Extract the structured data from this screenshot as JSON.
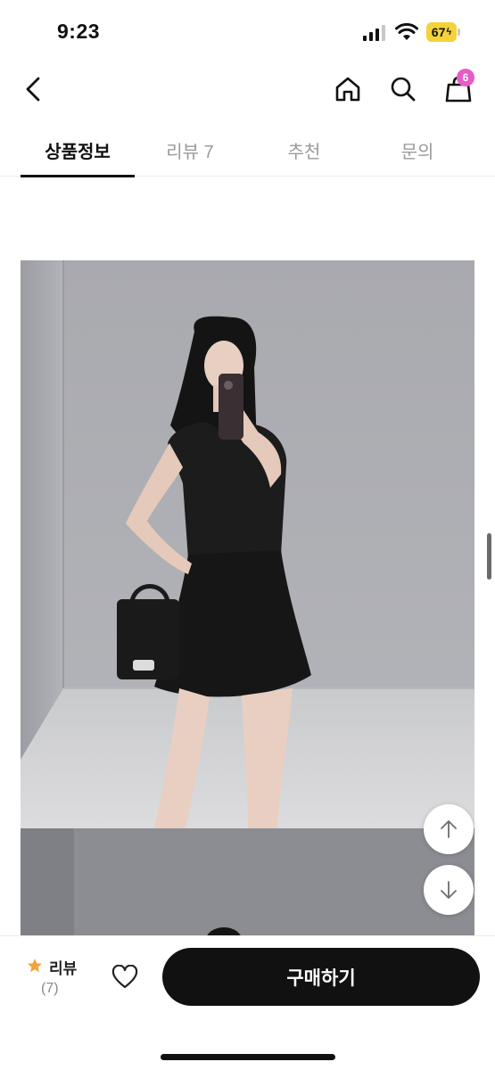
{
  "status_bar": {
    "time": "9:23",
    "battery": "67",
    "icons": [
      "signal-icon",
      "wifi-icon",
      "battery-icon"
    ]
  },
  "nav": {
    "icons": [
      "back-icon",
      "home-icon",
      "search-icon",
      "cart-icon"
    ],
    "cart_badge": "6"
  },
  "tabs": [
    {
      "label": "상품정보",
      "active": true
    },
    {
      "label": "리뷰 7",
      "active": false
    },
    {
      "label": "추천",
      "active": false
    },
    {
      "label": "문의",
      "active": false
    }
  ],
  "bottom_bar": {
    "review_label": "리뷰",
    "review_count": "(7)",
    "buy_label": "구매하기"
  },
  "colors": {
    "accent_badge": "#e55cc8",
    "battery": "#f4d33a",
    "buy_button": "#111111",
    "star": "#f2a33a"
  }
}
